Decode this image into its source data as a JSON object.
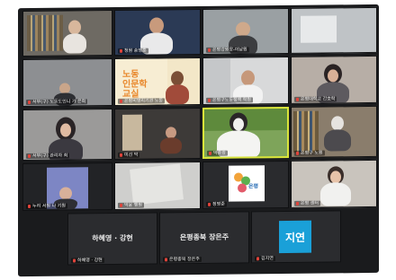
{
  "participants": [
    {
      "name": "",
      "row": 1,
      "col": 1
    },
    {
      "name": "청원 송영훈",
      "row": 1,
      "col": 2
    },
    {
      "name": "은평강원장-이남원",
      "row": 1,
      "col": 3
    },
    {
      "name": "",
      "row": 1,
      "col": 4
    },
    {
      "name": "서부(구) 노동도인니 가 은회",
      "row": 2,
      "col": 1
    },
    {
      "name": "은평비영리기관 노동",
      "row": 2,
      "col": 2
    },
    {
      "name": "은평구노동정책 학원",
      "row": 2,
      "col": 3
    },
    {
      "name": "은평대학교 간호학",
      "row": 2,
      "col": 4
    },
    {
      "name": "서부(구) 관리자 최",
      "row": 3,
      "col": 1
    },
    {
      "name": "미선 박",
      "row": 3,
      "col": 2
    },
    {
      "name": "박중광",
      "row": 3,
      "col": 3
    },
    {
      "name": "은평구 노원",
      "row": 3,
      "col": 4
    },
    {
      "name": "누리 서원 나 기원",
      "row": 4,
      "col": 1
    },
    {
      "name": "박윤 행원",
      "row": 4,
      "col": 2
    },
    {
      "name": "정명준",
      "row": 4,
      "col": 3
    },
    {
      "name": "은평 센터",
      "row": 4,
      "col": 4
    }
  ],
  "poster": {
    "line1": "노동",
    "line2": "인문학",
    "line3": "교실"
  },
  "logo_text": "은평",
  "bottom_tiles": [
    {
      "label": "하혜영 · 강현",
      "name": "하혜영 · 강현"
    },
    {
      "label": "은평종북 장은주",
      "name": "은평종북 장은주"
    },
    {
      "label": "지연",
      "name": "김지연"
    }
  ],
  "colors": {
    "active_border": "#d9e43a",
    "avatar_blue": "#1aa0d8",
    "poster_orange": "#e8872b",
    "muted_mic": "#e0433a"
  }
}
